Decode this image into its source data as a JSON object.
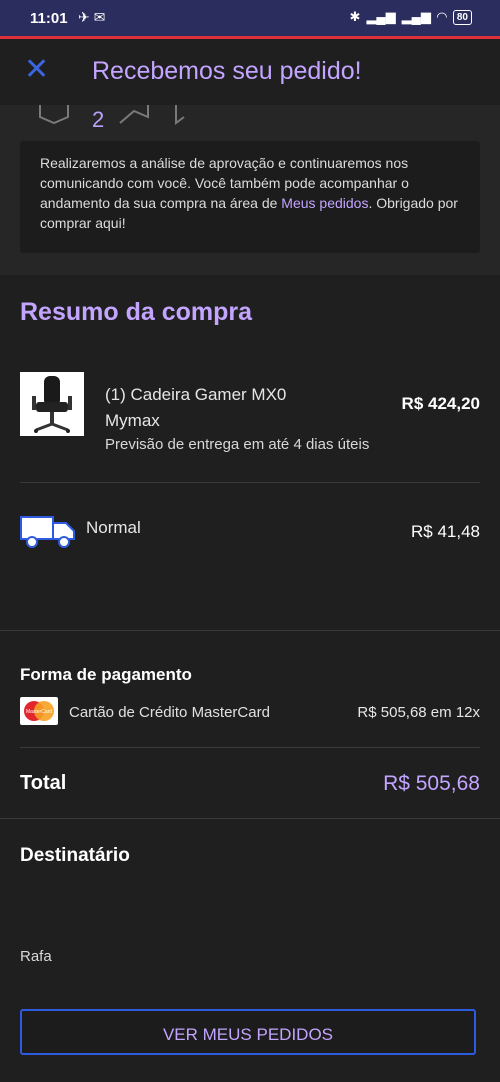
{
  "status_bar": {
    "time": "11:01",
    "battery": "80"
  },
  "header": {
    "title": "Recebemos seu pedido!"
  },
  "steps": {
    "visible_number": "2"
  },
  "confirmation": {
    "text_before": "Realizaremos a análise de aprovação e continuaremos nos comunicando com você. Você também pode acompanhar o andamento da sua compra na área de ",
    "link": "Meus pedidos",
    "text_after": ". Obrigado por comprar aqui!"
  },
  "summary": {
    "title": "Resumo da compra",
    "product": {
      "name": "(1) Cadeira Gamer MX0 Mymax",
      "price": "R$ 424,20",
      "delivery": "Previsão de entrega em até 4 dias úteis"
    },
    "shipping": {
      "label": "Normal",
      "price": "R$ 41,48"
    }
  },
  "payment": {
    "title": "Forma de pagamento",
    "method": "Cartão de Crédito MasterCard",
    "amount": "R$ 505,68 em 12x",
    "logo_text": "MasterCard"
  },
  "total": {
    "label": "Total",
    "value": "R$ 505,68"
  },
  "recipient": {
    "title": "Destinatário",
    "name": "Rafa"
  },
  "cta": {
    "label": "VER MEUS PEDIDOS"
  },
  "colors": {
    "accent": "#c3a4ff",
    "primary_blue": "#2f5be0",
    "background": "#1f1f1f"
  }
}
